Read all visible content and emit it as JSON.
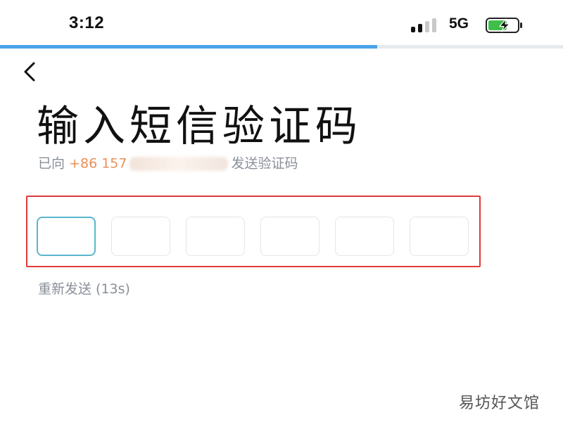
{
  "status_bar": {
    "time": "3:12",
    "network": "5G",
    "signal_bars_active": 2,
    "signal_bars_total": 4,
    "battery_icon": "battery-charging-icon",
    "battery_color": "#3fbf4a"
  },
  "top_progress": {
    "fraction": 0.67,
    "color": "#4aa3ea"
  },
  "nav": {
    "back_icon": "chevron-left-icon"
  },
  "title": "输入短信验证码",
  "subtitle": {
    "prefix": "已向",
    "phone_visible": "+86 157",
    "suffix": "发送验证码"
  },
  "code_inputs": {
    "count": 6,
    "active_index": 0,
    "values": [
      "",
      "",
      "",
      "",
      "",
      ""
    ],
    "active_color": "#5ab7cf",
    "highlight_color": "#e03a3a"
  },
  "resend": {
    "label": "重新发送 (13s)"
  },
  "watermark": "易坊好文馆"
}
